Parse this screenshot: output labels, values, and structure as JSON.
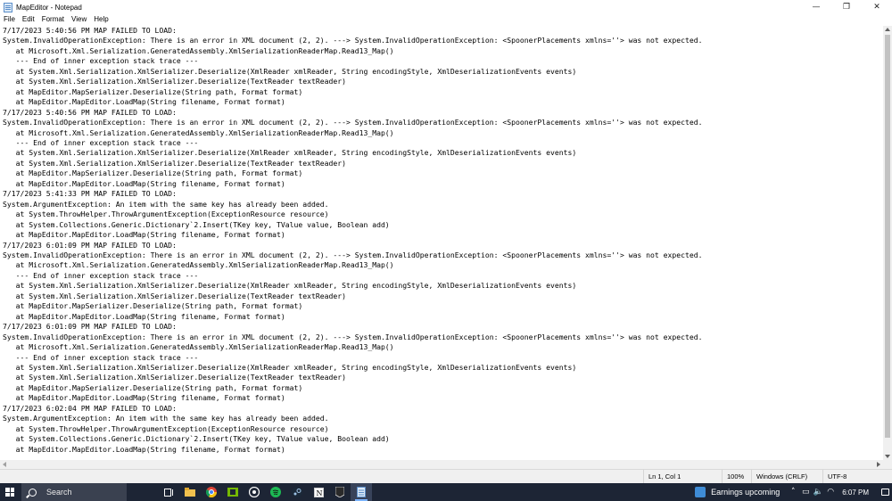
{
  "window": {
    "title": "MapEditor - Notepad",
    "controls": {
      "minimize": "—",
      "restore": "❐",
      "close": "✕"
    }
  },
  "menu": [
    "File",
    "Edit",
    "Format",
    "View",
    "Help"
  ],
  "editor": {
    "lines": [
      "7/17/2023 5:40:56 PM MAP FAILED TO LOAD:",
      "System.InvalidOperationException: There is an error in XML document (2, 2). ---> System.InvalidOperationException: <SpoonerPlacements xmlns=''> was not expected.",
      "   at Microsoft.Xml.Serialization.GeneratedAssembly.XmlSerializationReaderMap.Read13_Map()",
      "   --- End of inner exception stack trace ---",
      "   at System.Xml.Serialization.XmlSerializer.Deserialize(XmlReader xmlReader, String encodingStyle, XmlDeserializationEvents events)",
      "   at System.Xml.Serialization.XmlSerializer.Deserialize(TextReader textReader)",
      "   at MapEditor.MapSerializer.Deserialize(String path, Format format)",
      "   at MapEditor.MapEditor.LoadMap(String filename, Format format)",
      "7/17/2023 5:40:56 PM MAP FAILED TO LOAD:",
      "System.InvalidOperationException: There is an error in XML document (2, 2). ---> System.InvalidOperationException: <SpoonerPlacements xmlns=''> was not expected.",
      "   at Microsoft.Xml.Serialization.GeneratedAssembly.XmlSerializationReaderMap.Read13_Map()",
      "   --- End of inner exception stack trace ---",
      "   at System.Xml.Serialization.XmlSerializer.Deserialize(XmlReader xmlReader, String encodingStyle, XmlDeserializationEvents events)",
      "   at System.Xml.Serialization.XmlSerializer.Deserialize(TextReader textReader)",
      "   at MapEditor.MapSerializer.Deserialize(String path, Format format)",
      "   at MapEditor.MapEditor.LoadMap(String filename, Format format)",
      "7/17/2023 5:41:33 PM MAP FAILED TO LOAD:",
      "System.ArgumentException: An item with the same key has already been added.",
      "   at System.ThrowHelper.ThrowArgumentException(ExceptionResource resource)",
      "   at System.Collections.Generic.Dictionary`2.Insert(TKey key, TValue value, Boolean add)",
      "   at MapEditor.MapEditor.LoadMap(String filename, Format format)",
      "7/17/2023 6:01:09 PM MAP FAILED TO LOAD:",
      "System.InvalidOperationException: There is an error in XML document (2, 2). ---> System.InvalidOperationException: <SpoonerPlacements xmlns=''> was not expected.",
      "   at Microsoft.Xml.Serialization.GeneratedAssembly.XmlSerializationReaderMap.Read13_Map()",
      "   --- End of inner exception stack trace ---",
      "   at System.Xml.Serialization.XmlSerializer.Deserialize(XmlReader xmlReader, String encodingStyle, XmlDeserializationEvents events)",
      "   at System.Xml.Serialization.XmlSerializer.Deserialize(TextReader textReader)",
      "   at MapEditor.MapSerializer.Deserialize(String path, Format format)",
      "   at MapEditor.MapEditor.LoadMap(String filename, Format format)",
      "7/17/2023 6:01:09 PM MAP FAILED TO LOAD:",
      "System.InvalidOperationException: There is an error in XML document (2, 2). ---> System.InvalidOperationException: <SpoonerPlacements xmlns=''> was not expected.",
      "   at Microsoft.Xml.Serialization.GeneratedAssembly.XmlSerializationReaderMap.Read13_Map()",
      "   --- End of inner exception stack trace ---",
      "   at System.Xml.Serialization.XmlSerializer.Deserialize(XmlReader xmlReader, String encodingStyle, XmlDeserializationEvents events)",
      "   at System.Xml.Serialization.XmlSerializer.Deserialize(TextReader textReader)",
      "   at MapEditor.MapSerializer.Deserialize(String path, Format format)",
      "   at MapEditor.MapEditor.LoadMap(String filename, Format format)",
      "7/17/2023 6:02:04 PM MAP FAILED TO LOAD:",
      "System.ArgumentException: An item with the same key has already been added.",
      "   at System.ThrowHelper.ThrowArgumentException(ExceptionResource resource)",
      "   at System.Collections.Generic.Dictionary`2.Insert(TKey key, TValue value, Boolean add)",
      "   at MapEditor.MapEditor.LoadMap(String filename, Format format)"
    ]
  },
  "status": {
    "position": "Ln 1, Col 1",
    "zoom": "100%",
    "line_ending": "Windows (CRLF)",
    "encoding": "UTF-8"
  },
  "taskbar": {
    "search_label": "Search",
    "news_label": "Earnings upcoming",
    "clock": "6:07 PM",
    "pinned_icons": [
      "file-explorer-icon",
      "chrome-icon",
      "nvidia-icon",
      "github-icon",
      "spotify-icon",
      "steam-icon",
      "notion-icon",
      "epic-games-icon",
      "notepad-icon"
    ],
    "active_app": "notepad-icon"
  },
  "colors": {
    "taskbar_bg": "#1d2535",
    "accent": "#7ab3ff",
    "spotify": "#1db954",
    "chrome_red": "#db4437"
  }
}
